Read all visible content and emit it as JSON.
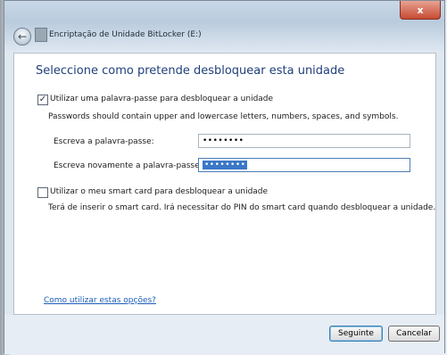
{
  "window": {
    "title": "Encriptação de Unidade BitLocker (E:)",
    "close_label": "x"
  },
  "content": {
    "heading": "Seleccione como pretende desbloquear esta unidade",
    "password_option": {
      "checked": true,
      "label": "Utilizar uma palavra-passe para desbloquear a unidade",
      "hint": "Passwords should contain upper and lowercase letters, numbers, spaces, and symbols.",
      "password_label": "Escreva a palavra-passe:",
      "password_value": "••••••••",
      "confirm_label": "Escreva novamente a palavra-passe:",
      "confirm_value": "••••••••"
    },
    "smartcard_option": {
      "checked": false,
      "label": "Utilizar o meu smart card para desbloquear a unidade",
      "hint": "Terá de inserir o smart card. Irá necessitar do PIN do smart card quando desbloquear a unidade."
    },
    "help_link": "Como utilizar estas opções?"
  },
  "footer": {
    "next_label": "Seguinte",
    "cancel_label": "Cancelar"
  },
  "icons": {
    "back": "back-arrow-icon",
    "app": "bitlocker-drive-icon",
    "close": "close-icon",
    "checkmark": "checkmark-icon"
  }
}
